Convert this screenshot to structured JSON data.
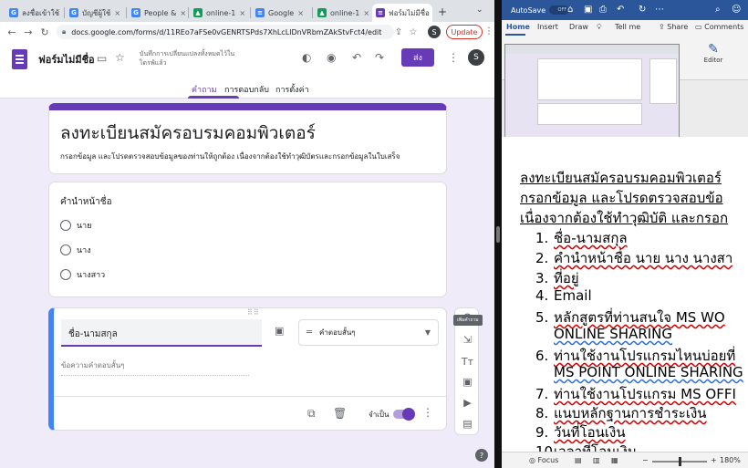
{
  "browser": {
    "tabs": [
      {
        "label": "ลงชื่อเข้าใช้",
        "favicon": "G",
        "color": "#4285f4"
      },
      {
        "label": "บัญชีผู้ใช้",
        "favicon": "G",
        "color": "#4285f4"
      },
      {
        "label": "People &",
        "favicon": "G",
        "color": "#4285f4"
      },
      {
        "label": "online-1",
        "favicon": "drive-icon",
        "color": "#0f9d58"
      },
      {
        "label": "Google",
        "favicon": "docs-icon",
        "color": "#4285f4"
      },
      {
        "label": "online-1",
        "favicon": "drive-icon",
        "color": "#0f9d58"
      },
      {
        "label": "ฟอร์มไม่มีชื่อ",
        "favicon": "forms-icon",
        "color": "#673ab7",
        "active": true
      }
    ],
    "url": "docs.google.com/forms/d/11REo7aFSe0vGENRTSPds7XhLcLlDnVRbmZAkStvFct4/edit",
    "profile_initial": "S",
    "update_label": "Update"
  },
  "forms": {
    "form_name": "ฟอร์มไม่มีชื่อ",
    "save_note": "บันทึกการเปลี่ยนแปลงทั้งหมดไว้ในไดรฟ์แล้ว",
    "send_label": "ส่ง",
    "avatar_initial": "S",
    "tabs": [
      "คำถาม",
      "การตอบกลับ",
      "การตั้งค่า"
    ],
    "accent_color": "#673ab7",
    "title": "ลงทะเบียนสมัครอบรมคอมพิวเตอร์",
    "description": "กรอกข้อมูล และโปรดตรวจสอบข้อมูลของท่านให้ถูกต้อง เนื่องจากต้องใช้ทำวุฒิบัตรและกรอกข้อมูลในใบเสร็จ",
    "question1": {
      "title": "คำนำหน้าชื่อ",
      "options": [
        "นาย",
        "นาง",
        "นางสาว"
      ]
    },
    "question2": {
      "title": "ชื่อ-นามสกุล",
      "type_label": "คำตอบสั้นๆ",
      "answer_placeholder": "ข้อความคำตอบสั้นๆ",
      "required_label": "จำเป็น",
      "required": true
    },
    "side_tooltip": "เพิ่มคำถาม"
  },
  "word": {
    "autosave_label": "AutoSave",
    "autosave_state": "OFF",
    "ribbon_tabs": [
      "Home",
      "Insert",
      "Draw",
      "Tell me"
    ],
    "share_label": "Share",
    "comments_label": "Comments",
    "editor_label": "Editor",
    "doc_lines": [
      "ลงทะเบียนสมัครอบรมคอมพิวเตอร์",
      "กรอกข้อมูล และโปรดตรวจสอบข้อ",
      "เนื่องจากต้องใช้ทำวุฒิบัติ และกรอก"
    ],
    "list": [
      {
        "num": "1.",
        "text": "ชื่อ-นามสกุล"
      },
      {
        "num": "2.",
        "text": "คำนำหน้าชื่อ นาย นาง นางสา"
      },
      {
        "num": "3.",
        "text": "ที่อยู่"
      },
      {
        "num": "4.",
        "text": "Email"
      },
      {
        "num": "5.",
        "text": "หลักสูตรที่ท่านสนใจ  MS WO"
      },
      {
        "num": "6.",
        "text": "ท่านใช้งานโปรแกรมไหนบ่อยที่"
      },
      {
        "num": "7.",
        "text": "ท่านใช้งานโปรแกรม MS OFFI"
      },
      {
        "num": "8.",
        "text": "แนบหลักฐานการชำระเงิน"
      },
      {
        "num": "9.",
        "text": "วันที่โอนเงิน"
      },
      {
        "num": "10.",
        "text": "เวลาที่โอนเงิน"
      }
    ],
    "continuations": [
      "ONLINE SHARING",
      "MS POINT  ONLINE SHARING"
    ],
    "focus_label": "Focus",
    "zoom": "180%"
  }
}
